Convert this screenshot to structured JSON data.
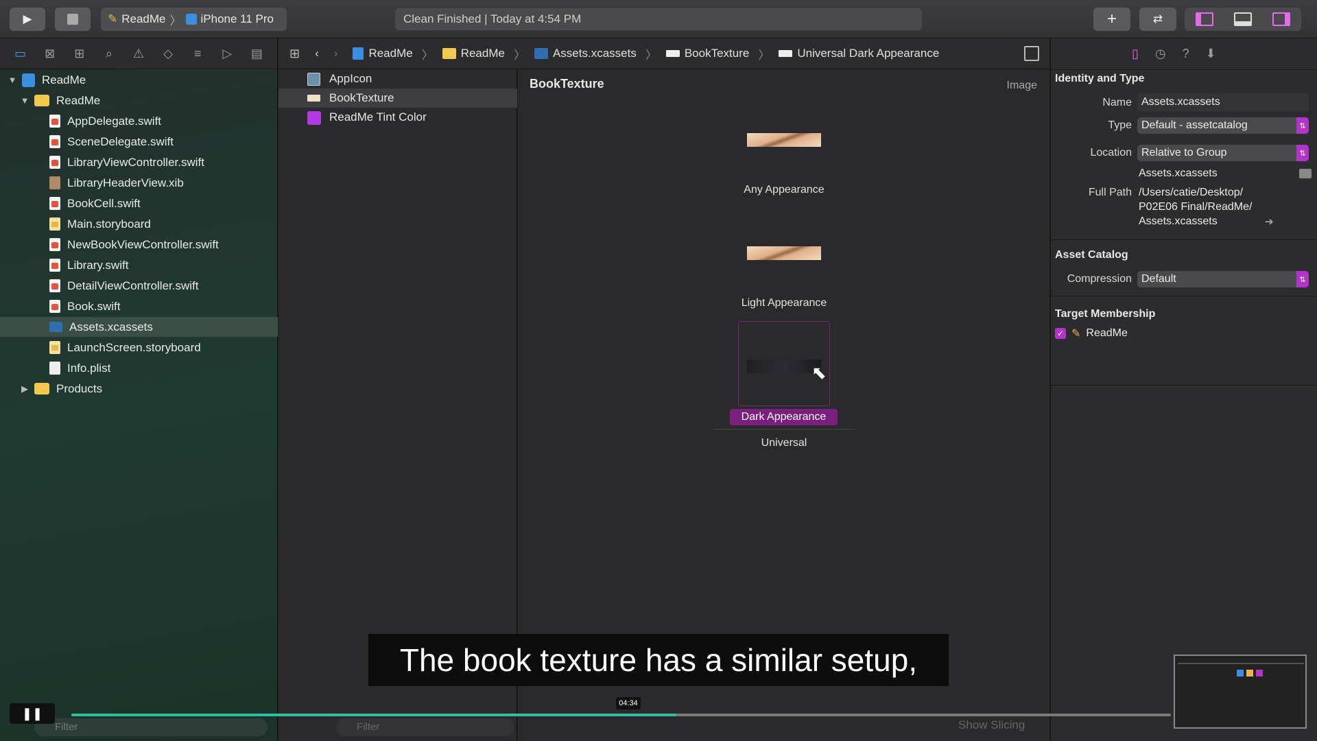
{
  "toolbar": {
    "scheme": "ReadMe",
    "device": "iPhone 11 Pro",
    "activity": "Clean Finished | Today at 4:54 PM"
  },
  "navigator": {
    "items": [
      {
        "label": "ReadMe",
        "type": "project",
        "level": 0,
        "expanded": true
      },
      {
        "label": "ReadMe",
        "type": "folder",
        "level": 1,
        "expanded": true
      },
      {
        "label": "AppDelegate.swift",
        "type": "swift",
        "level": 2
      },
      {
        "label": "SceneDelegate.swift",
        "type": "swift",
        "level": 2
      },
      {
        "label": "LibraryViewController.swift",
        "type": "swift",
        "level": 2
      },
      {
        "label": "LibraryHeaderView.xib",
        "type": "xib",
        "level": 2
      },
      {
        "label": "BookCell.swift",
        "type": "swift",
        "level": 2
      },
      {
        "label": "Main.storyboard",
        "type": "storyboard",
        "level": 2
      },
      {
        "label": "NewBookViewController.swift",
        "type": "swift",
        "level": 2
      },
      {
        "label": "Library.swift",
        "type": "swift",
        "level": 2
      },
      {
        "label": "DetailViewController.swift",
        "type": "swift",
        "level": 2
      },
      {
        "label": "Book.swift",
        "type": "swift",
        "level": 2
      },
      {
        "label": "Assets.xcassets",
        "type": "xcassets",
        "level": 2,
        "selected": true
      },
      {
        "label": "LaunchScreen.storyboard",
        "type": "storyboard",
        "level": 2
      },
      {
        "label": "Info.plist",
        "type": "plist",
        "level": 2
      },
      {
        "label": "Products",
        "type": "folder",
        "level": 1,
        "expanded": false
      }
    ],
    "filter_placeholder": "Filter"
  },
  "jumpbar": {
    "crumbs": [
      "ReadMe",
      "ReadMe",
      "Assets.xcassets",
      "BookTexture",
      "Universal Dark Appearance"
    ]
  },
  "assets": {
    "items": [
      {
        "label": "AppIcon"
      },
      {
        "label": "BookTexture",
        "selected": true
      },
      {
        "label": "ReadMe Tint Color"
      }
    ],
    "filter_placeholder": "Filter"
  },
  "editor": {
    "title": "BookTexture",
    "kind": "Image",
    "slots": [
      "Any Appearance",
      "Light Appearance",
      "Dark Appearance"
    ],
    "group_label": "Universal",
    "show_slicing": "Show Slicing"
  },
  "inspector": {
    "identity_header": "Identity and Type",
    "name_label": "Name",
    "name_value": "Assets.xcassets",
    "type_label": "Type",
    "type_value": "Default - assetcatalog",
    "location_label": "Location",
    "location_value": "Relative to Group",
    "location_file": "Assets.xcassets",
    "fullpath_label": "Full Path",
    "fullpath_line1": "/Users/catie/Desktop/",
    "fullpath_line2": "P02E06 Final/ReadMe/",
    "fullpath_line3": "Assets.xcassets",
    "catalog_header": "Asset Catalog",
    "compression_label": "Compression",
    "compression_value": "Default",
    "membership_header": "Target Membership",
    "membership_target": "ReadMe",
    "membership_checked": true
  },
  "video": {
    "subtitle": "The book texture has a similar setup,",
    "timestamp": "04:34",
    "progress": 0.55
  },
  "colors": {
    "accent": "#b234c9",
    "navigator_bg": "#1f3a31",
    "progress": "#2fbfa0"
  }
}
